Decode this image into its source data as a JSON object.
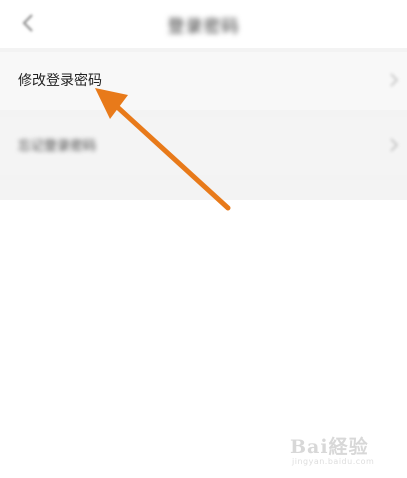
{
  "header": {
    "title": "登录密码",
    "back_icon": "chevron-left-icon"
  },
  "settings": {
    "items": [
      {
        "label": "修改登录密码",
        "icon": "chevron-right-icon"
      },
      {
        "label": "忘记登录密码",
        "icon": "chevron-right-icon"
      }
    ]
  },
  "annotation": {
    "arrow_color": "#e87a1a"
  },
  "watermark": {
    "brand": "Bai経验",
    "url": "jingyan.baidu.com"
  }
}
